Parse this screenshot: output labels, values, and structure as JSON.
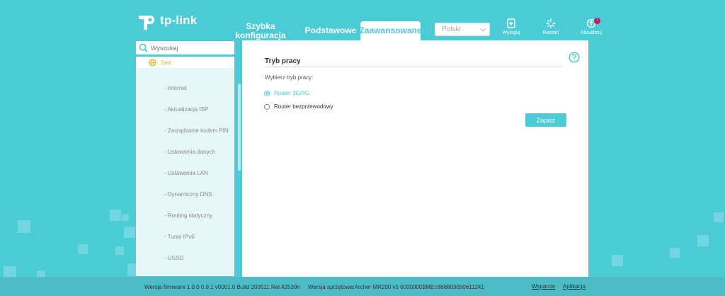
{
  "brand": {
    "logo_text": "tp-link"
  },
  "nav": {
    "tabs": [
      {
        "line1": "Szybka",
        "line2": "konfiguracja"
      },
      {
        "label": "Podstawowe"
      },
      {
        "label": "Zaawansowane"
      }
    ]
  },
  "language": {
    "selected": "Polski"
  },
  "header_buttons": {
    "logout": "Wyloguj",
    "restart": "Restart",
    "update": "Aktualizuj",
    "update_badge": "!"
  },
  "search": {
    "placeholder": "Wyszukaj"
  },
  "sidebar": {
    "section": "Sieć",
    "items": [
      "- Internet",
      "- Aktualizacja ISP",
      "- Zarządzanie kodem PIN",
      "- Ustawienia danych",
      "- Ustawienia LAN",
      "- Dynamiczny DNS",
      "- Routing statyczny",
      "- Tunel IPv6",
      "- USSD"
    ]
  },
  "main": {
    "title": "Tryb pracy",
    "mode_label": "Wybierz tryb pracy:",
    "options": [
      "Router 3G/4G",
      "Router bezprzewodowy"
    ],
    "selected": 0,
    "save": "Zapisz"
  },
  "footer": {
    "firmware": "Wersja firmware 1.0.0 0.9.1 v0001.0 Build 200511 Rel.42539n",
    "hardware": "Wersja sprzętowa:Archer MR200 v5 00000001",
    "imei": "IMEI:868803050611241",
    "support": "Wsparcie",
    "app": "Aplikacja"
  },
  "colors": {
    "accent": "#4acbd6",
    "badge": "#c3185d",
    "sidebar_section": "#f0b40f"
  }
}
